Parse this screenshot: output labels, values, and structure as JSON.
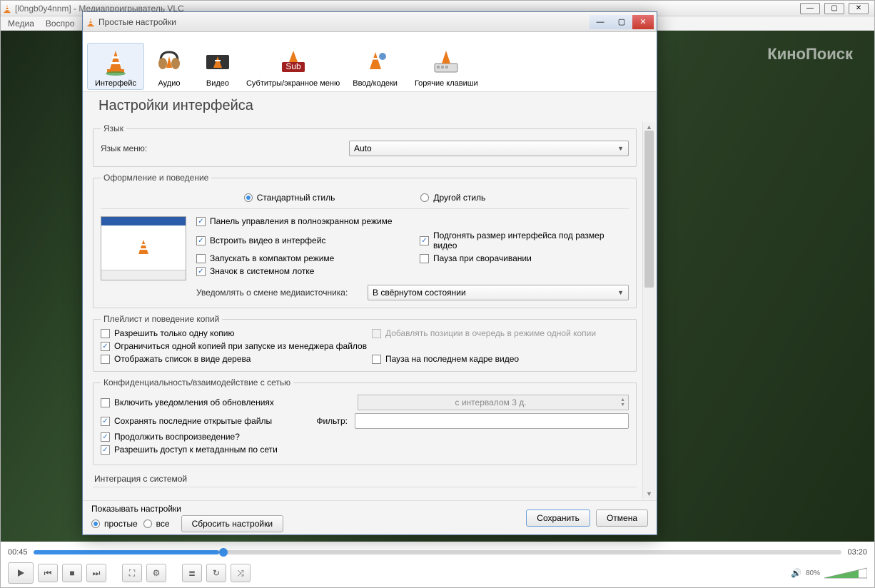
{
  "main_window": {
    "title": "[l0ngb0y4nnm] - Медиапроигрыватель VLC",
    "menu": {
      "media": "Медиа",
      "playback": "Воспро"
    },
    "watermark": "КиноПоиск",
    "time_current": "00:45",
    "time_total": "03:20",
    "volume_percent": "80%"
  },
  "prefs": {
    "title": "Простые настройки",
    "categories": {
      "interface": "Интерфейс",
      "audio": "Аудио",
      "video": "Видео",
      "subtitles": "Субтитры/экранное меню",
      "input": "Ввод/кодеки",
      "hotkeys": "Горячие клавиши"
    },
    "heading": "Настройки интерфейса",
    "language": {
      "legend": "Язык",
      "menu_label": "Язык меню:",
      "value": "Auto"
    },
    "look": {
      "legend": "Оформление и поведение",
      "style_standard": "Стандартный стиль",
      "style_custom": "Другой стиль",
      "chk_fullscreen_panel": "Панель управления в полноэкранном режиме",
      "chk_embed_video": "Встроить видео в интерфейс",
      "chk_resize": "Подгонять размер интерфейса под размер видео",
      "chk_compact": "Запускать в компактом режиме",
      "chk_pause_min": "Пауза при сворачивании",
      "chk_tray": "Значок в системном лотке",
      "notify_label": "Уведомлять о смене медиаисточника:",
      "notify_value": "В свёрнутом состоянии"
    },
    "playlist": {
      "legend": "Плейлист и поведение копий",
      "chk_one_instance": "Разрешить только одну копию",
      "chk_enqueue": "Добавлять позиции в очередь в режиме одной копии",
      "chk_one_from_fm": "Ограничиться одной копией при запуске из менеджера файлов",
      "chk_tree": "Отображать список в виде дерева",
      "chk_pause_last": "Пауза на последнем кадре видео"
    },
    "privacy": {
      "legend": "Конфиденциальность/взаимодействие с сетью",
      "chk_updates": "Включить уведомления об обновлениях",
      "interval": "с интервалом 3 д.",
      "chk_recent": "Сохранять последние открытые файлы",
      "filter_label": "Фильтр:",
      "chk_continue": "Продолжить воспроизведение?",
      "chk_metadata": "Разрешить доступ к метаданным по сети"
    },
    "os_integration": "Интеграция с системой",
    "footer": {
      "show_label": "Показывать настройки",
      "simple": "простые",
      "all": "все",
      "reset": "Сбросить настройки",
      "save": "Сохранить",
      "cancel": "Отмена"
    }
  }
}
